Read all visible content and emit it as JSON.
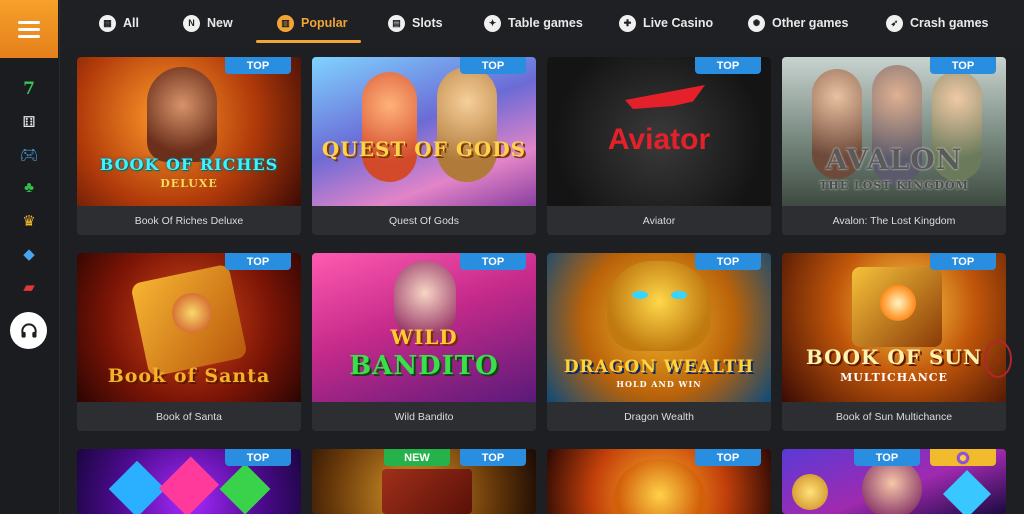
{
  "nav": {
    "tabs": [
      {
        "label": "All",
        "icon": "grid-icon"
      },
      {
        "label": "New",
        "icon": "new-icon"
      },
      {
        "label": "Popular",
        "icon": "popular-icon"
      },
      {
        "label": "Slots",
        "icon": "slots-icon"
      },
      {
        "label": "Table games",
        "icon": "table-games-icon"
      },
      {
        "label": "Live Casino",
        "icon": "live-casino-icon"
      },
      {
        "label": "Other games",
        "icon": "other-games-icon"
      },
      {
        "label": "Crash games",
        "icon": "crash-games-icon"
      }
    ],
    "active": "Popular"
  },
  "sidebar": {
    "icons": [
      "seven-icon",
      "dice-icon",
      "gamepad-icon",
      "clover-icon",
      "crown-icon",
      "diamond-icon",
      "cards-icon"
    ],
    "support_icon": "headset-icon"
  },
  "badges": {
    "top": "TOP",
    "new": "NEW"
  },
  "games": [
    {
      "name": "Book Of Riches Deluxe",
      "art": "BOOK OF RICHES",
      "art2": "DELUXE",
      "badge": "TOP"
    },
    {
      "name": "Quest Of Gods",
      "art": "QUEST OF GODS",
      "art2": "",
      "badge": "TOP"
    },
    {
      "name": "Aviator",
      "art": "Aviator",
      "art2": "",
      "badge": "TOP"
    },
    {
      "name": "Avalon: The Lost Kingdom",
      "art": "AVALON",
      "art2": "THE LOST KINGDOM",
      "badge": "TOP"
    },
    {
      "name": "Book of Santa",
      "art": "Book of Santa",
      "art2": "",
      "badge": "TOP"
    },
    {
      "name": "Wild Bandito",
      "art": "WILD",
      "art2": "BANDITO",
      "badge": "TOP"
    },
    {
      "name": "Dragon Wealth",
      "art": "DRAGON WEALTH",
      "art2": "HOLD AND WIN",
      "badge": "TOP"
    },
    {
      "name": "Book of Sun Multichance",
      "art": "BOOK OF SUN",
      "art2": "MULTICHANCE",
      "badge": "TOP"
    }
  ],
  "colors": {
    "accent": "#f3a437",
    "top_badge": "#2a8ee0",
    "new_badge": "#26b24b"
  }
}
